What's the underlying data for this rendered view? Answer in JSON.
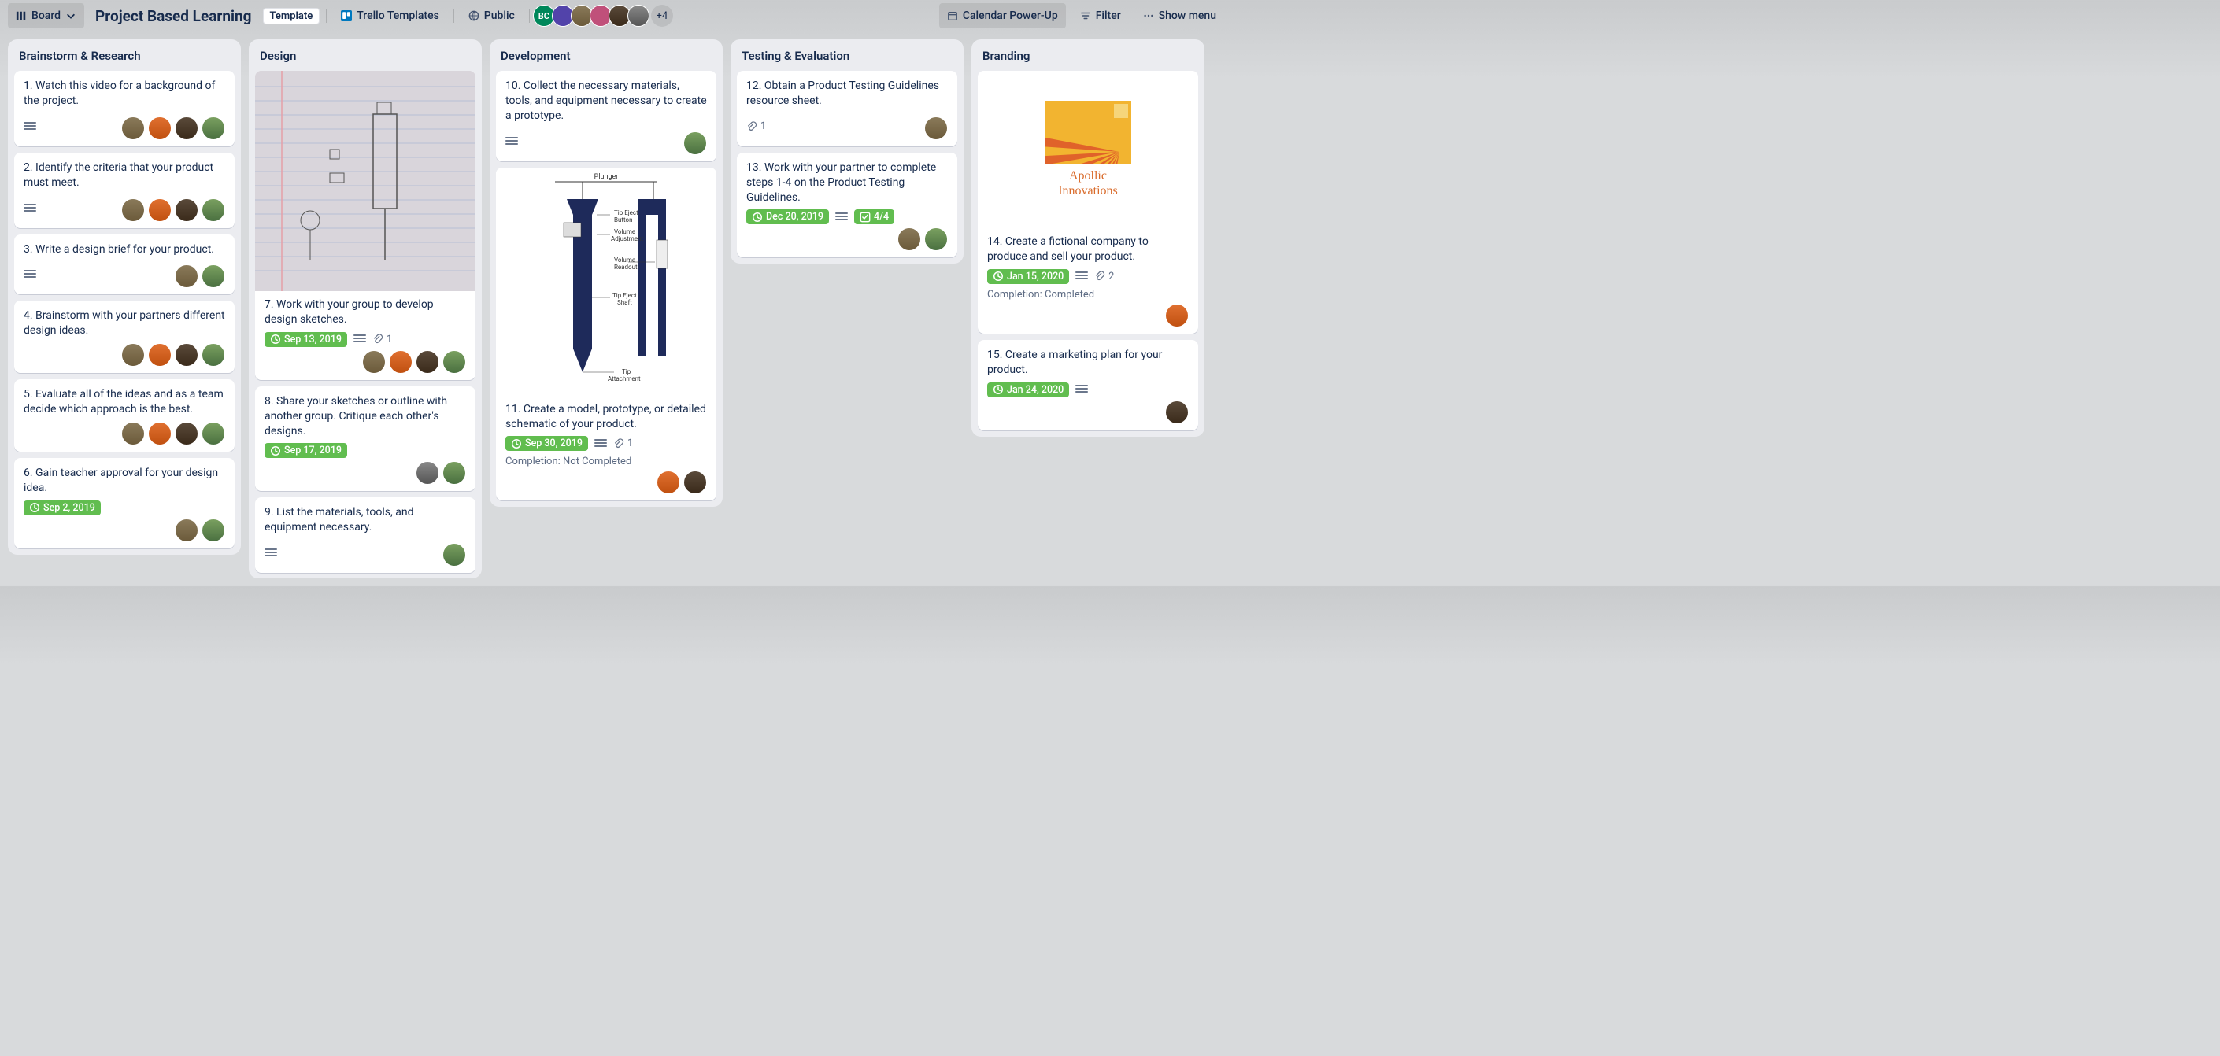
{
  "header": {
    "view_switch": "Board",
    "title": "Project Based Learning",
    "template_badge": "Template",
    "workspace": "Trello Templates",
    "visibility": "Public",
    "extra_members": "+4",
    "calendar": "Calendar Power-Up",
    "filter": "Filter",
    "show_menu": "Show menu",
    "avatars": [
      "BC",
      "",
      "",
      "",
      "",
      ""
    ]
  },
  "lists": [
    {
      "title": "Brainstorm & Research",
      "cards": [
        {
          "title": "1. Watch this video for a background of the project.",
          "desc": true,
          "members": [
            "av1",
            "av2",
            "av3",
            "av4"
          ]
        },
        {
          "title": "2. Identify the criteria that your product must meet.",
          "desc": true,
          "members": [
            "av1",
            "av2",
            "av3",
            "av4"
          ]
        },
        {
          "title": "3. Write a design brief for your product.",
          "desc": true,
          "members": [
            "av1",
            "av4"
          ]
        },
        {
          "title": "4. Brainstorm with your partners different design ideas.",
          "members": [
            "av1",
            "av2",
            "av3",
            "av4"
          ]
        },
        {
          "title": "5. Evaluate all of the ideas and as a team decide which approach is the best.",
          "members": [
            "av1",
            "av2",
            "av3",
            "av4"
          ]
        },
        {
          "title": "6. Gain teacher approval for your design idea.",
          "date": "Sep 2, 2019",
          "members": [
            "av1",
            "av4"
          ]
        }
      ]
    },
    {
      "title": "Design",
      "cards": [
        {
          "cover": "sketch",
          "title": "7. Work with your group to develop design sketches.",
          "date": "Sep 13, 2019",
          "desc": true,
          "attach": "1",
          "members": [
            "av1",
            "av2",
            "av3",
            "av4"
          ]
        },
        {
          "title": "8. Share your sketches or outline with another group. Critique each other's designs.",
          "date": "Sep 17, 2019",
          "members": [
            "av5",
            "av4"
          ]
        },
        {
          "title": "9. List the materials, tools, and equipment necessary.",
          "desc": true,
          "members": [
            "av4"
          ]
        }
      ]
    },
    {
      "title": "Development",
      "cards": [
        {
          "title": "10. Collect the necessary materials, tools, and equipment necessary to create a prototype.",
          "desc": true,
          "members": [
            "av4"
          ]
        },
        {
          "cover": "pipette",
          "title": "11. Create a model, prototype, or detailed schematic of your product.",
          "date": "Sep 30, 2019",
          "desc": true,
          "attach": "1",
          "meta": "Completion: Not Completed",
          "members": [
            "av2",
            "av3"
          ]
        }
      ]
    },
    {
      "title": "Testing & Evaluation",
      "cards": [
        {
          "title": "12. Obtain a Product Testing Guidelines resource sheet.",
          "attach": "1",
          "members": [
            "av1"
          ]
        },
        {
          "title": "13. Work with your partner to complete steps 1-4 on the Product Testing Guidelines.",
          "date": "Dec 20, 2019",
          "desc": true,
          "checklist": "4/4",
          "members": [
            "av1",
            "av4"
          ]
        }
      ]
    },
    {
      "title": "Branding",
      "cards": [
        {
          "cover": "brand",
          "title": "14. Create a fictional company to produce and sell your product.",
          "date": "Jan 15, 2020",
          "desc": true,
          "attach": "2",
          "meta": "Completion: Completed",
          "members": [
            "av2"
          ],
          "brand_name": "Apollic",
          "brand_sub": "Innovations"
        },
        {
          "title": "15. Create a marketing plan for your product.",
          "date": "Jan 24, 2020",
          "desc": true,
          "members": [
            "av3"
          ]
        }
      ]
    }
  ]
}
